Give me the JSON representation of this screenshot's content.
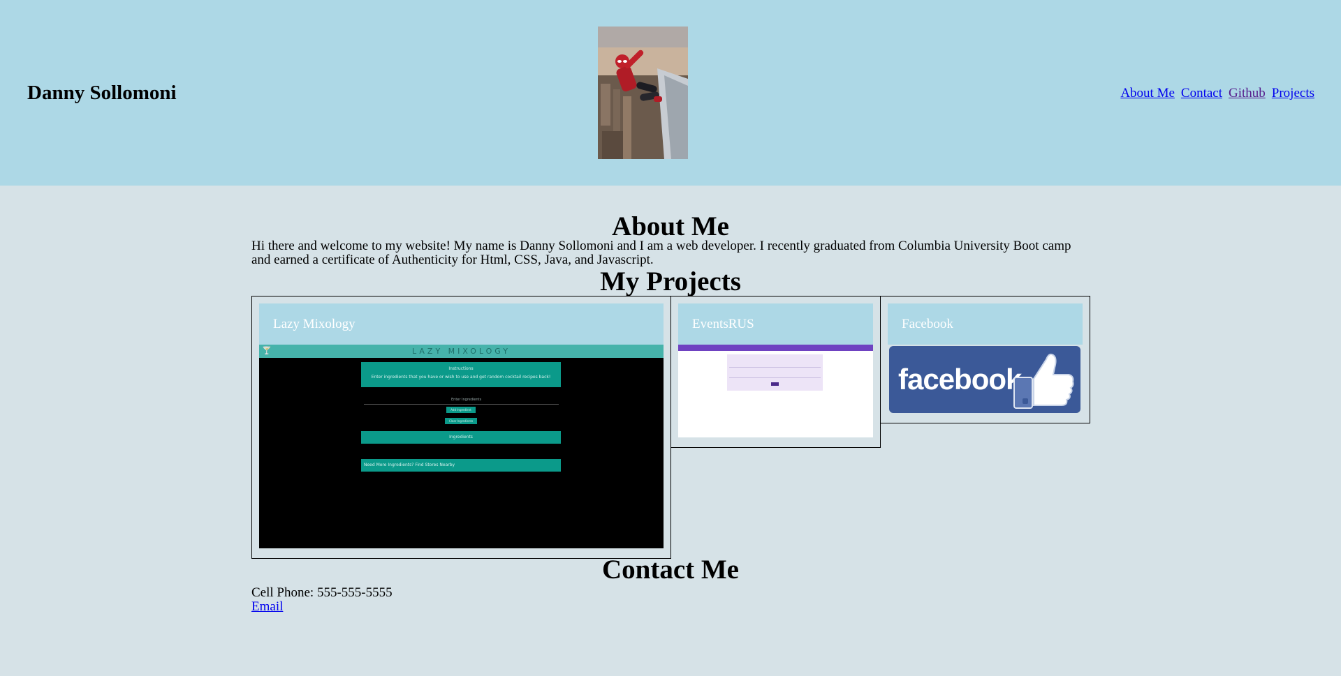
{
  "header": {
    "site_title": "Danny Sollomoni",
    "hero_icon": "spiderman-photo",
    "nav": [
      {
        "label": "About Me"
      },
      {
        "label": "Contact"
      },
      {
        "label": "Github"
      },
      {
        "label": "Projects"
      }
    ]
  },
  "about": {
    "title": "About Me",
    "text": "Hi there and welcome to my website! My name is Danny Sollomoni and I am a web developer. I recently graduated from Columbia University Boot camp and earned a certificate of Authenticity for Html, CSS, Java, and Javascript."
  },
  "projects": {
    "title": "My Projects",
    "items": [
      {
        "title": "Lazy Mixology",
        "screenshot": {
          "app_title": "LAZY MIXOLOGY",
          "instructions_title": "Instructions",
          "instructions_text": "Enter ingredients that you have or wish to use and get random cocktail recipes back!",
          "input_label": "Enter Ingredients",
          "add_button": "Add Ingredient",
          "clear_button": "Clear Ingredients",
          "ingredients_label": "Ingredients",
          "stores_label": "Need More Ingredients? Find Stores Nearby"
        }
      },
      {
        "title": "EventsRUS"
      },
      {
        "title": "Facebook",
        "logo_text": "facebook"
      }
    ]
  },
  "contact": {
    "title": "Contact Me",
    "phone": "Cell Phone: 555-555-5555",
    "email_label": "Email"
  },
  "colors": {
    "header_bg": "#add8e6",
    "page_bg": "#d6e2e7",
    "card_header_bg": "#add8e6",
    "link": "#0000ee",
    "link_visited": "#551a8b",
    "mixology_teal": "#0b9a8a",
    "events_purple": "#6f42c1",
    "facebook_blue": "#3b5998"
  }
}
